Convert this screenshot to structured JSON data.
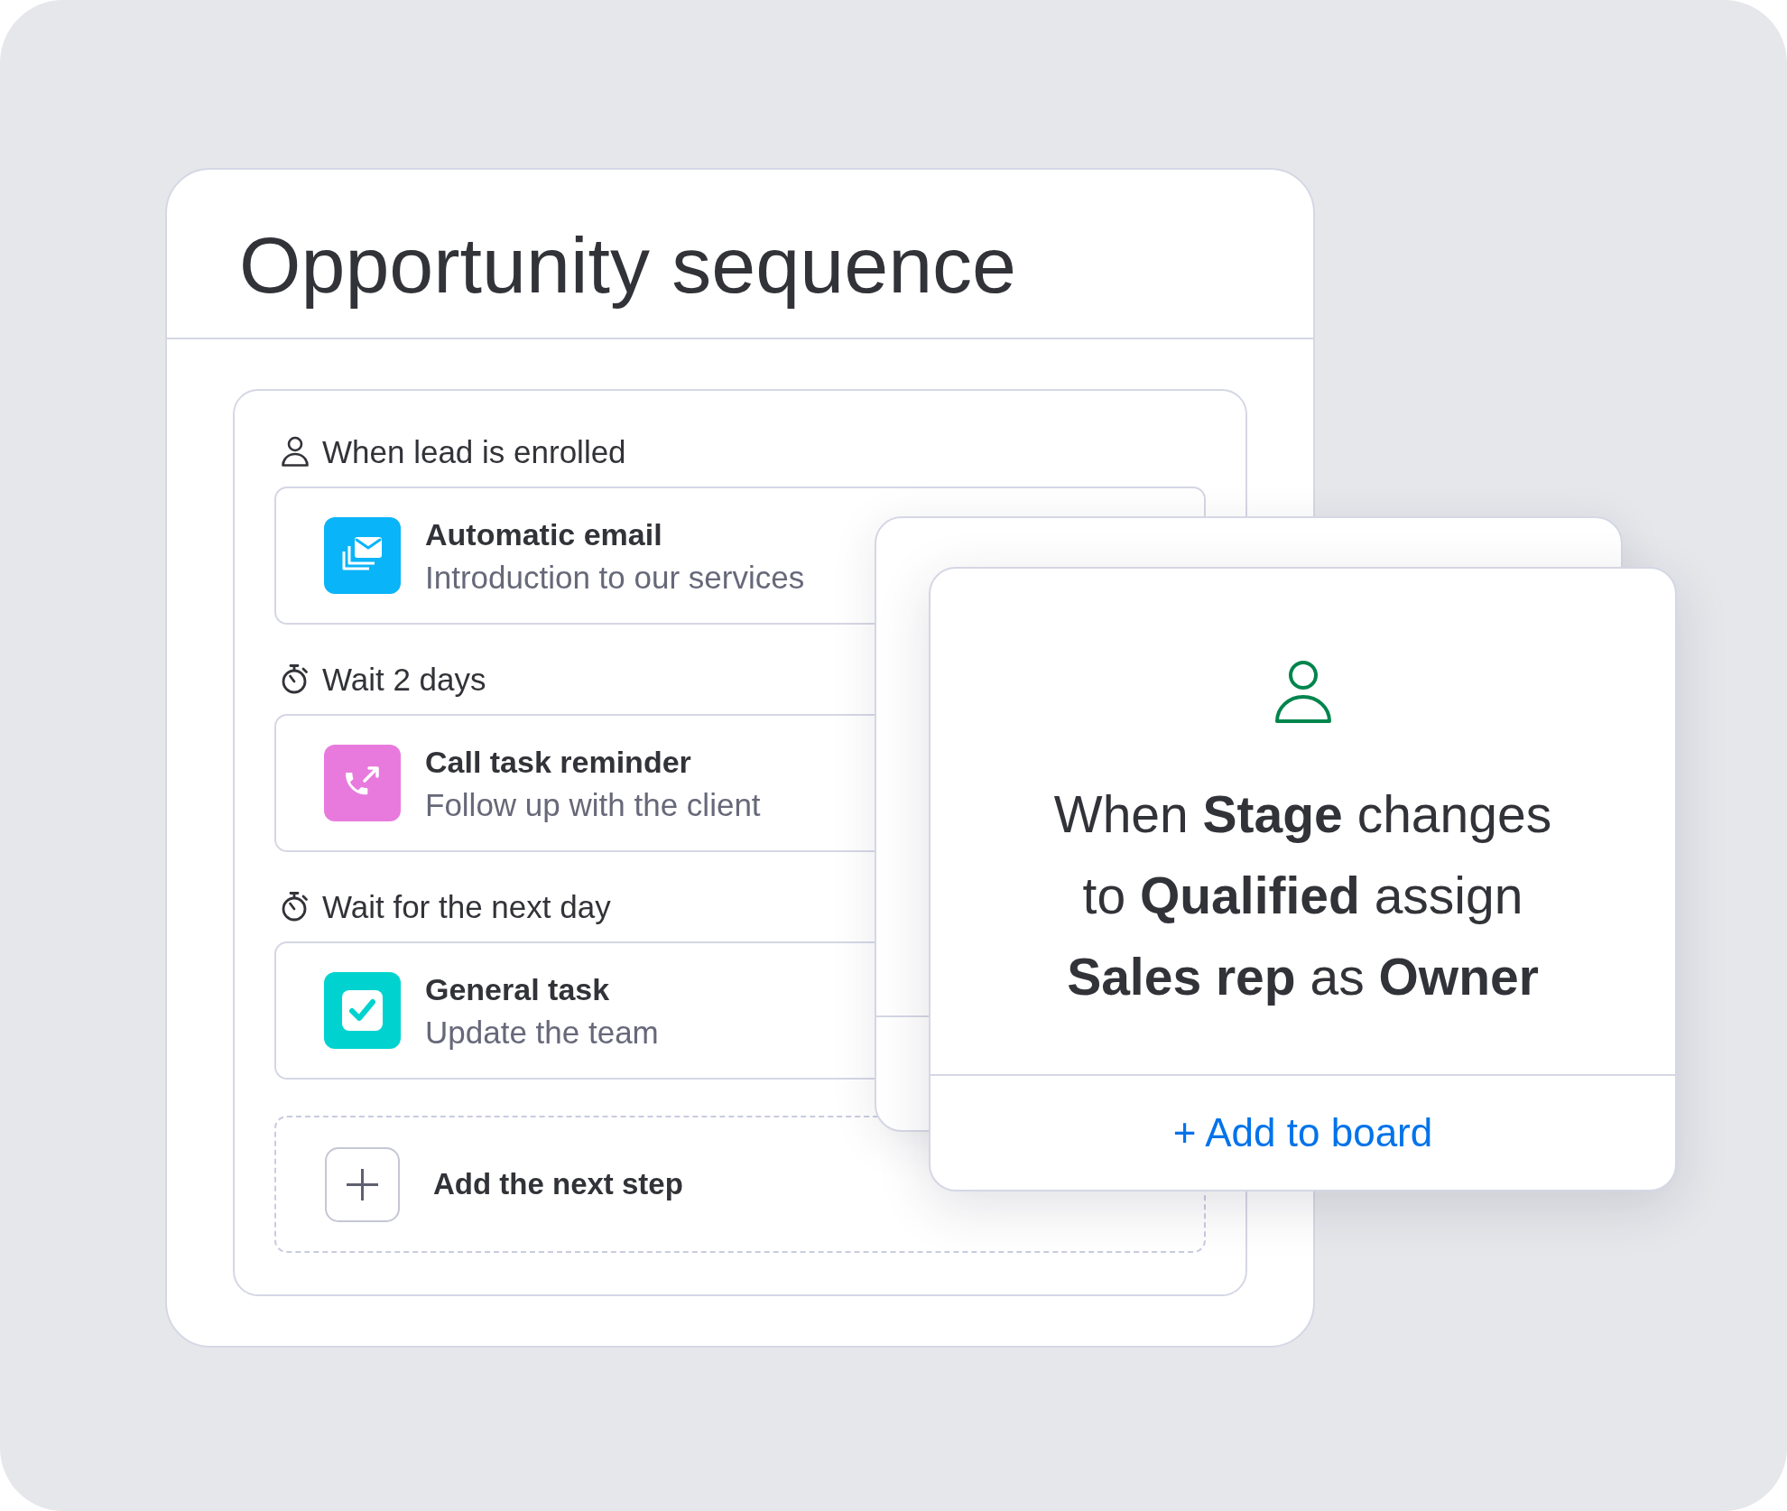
{
  "sequence": {
    "title": "Opportunity sequence",
    "steps": [
      {
        "trigger": {
          "kind": "person",
          "label": "When lead is enrolled"
        },
        "action": {
          "kind": "email",
          "title": "Automatic email",
          "subtitle": "Introduction to our services"
        }
      },
      {
        "trigger": {
          "kind": "timer",
          "label": "Wait 2 days"
        },
        "action": {
          "kind": "call",
          "title": "Call task reminder",
          "subtitle": "Follow up with the client"
        }
      },
      {
        "trigger": {
          "kind": "timer",
          "label": "Wait for the next day"
        },
        "action": {
          "kind": "task",
          "title": "General task",
          "subtitle": "Update the team"
        }
      }
    ],
    "add_step": {
      "label": "Add the next step"
    }
  },
  "automation_card": {
    "text": "When **Stage** changes to **Qualified** assign **Sales rep** as **Owner**",
    "button": "+ Add to board"
  }
}
